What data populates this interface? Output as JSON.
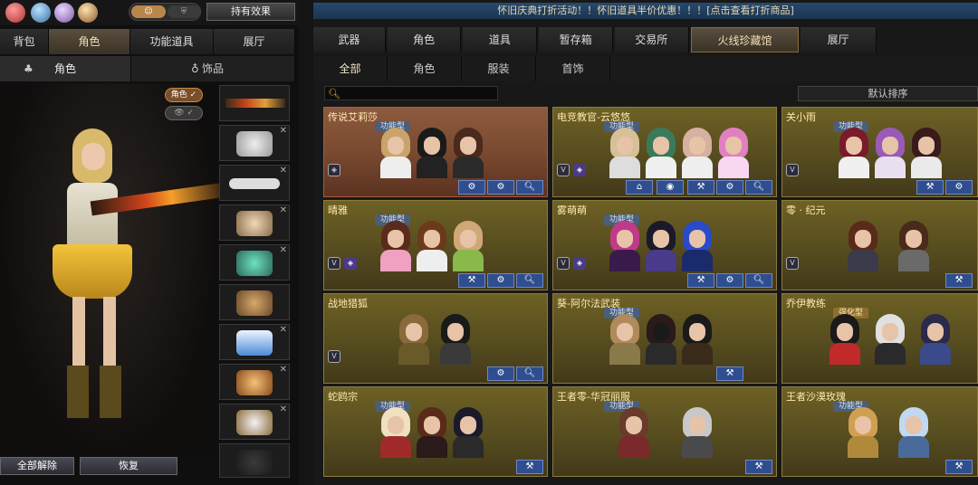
{
  "left": {
    "effect_btn": "持有效果",
    "tabs": [
      "背包",
      "角色",
      "功能道具",
      "展厅"
    ],
    "active_tab": 1,
    "subtabs": [
      "角色",
      "饰品"
    ],
    "chip_role": "角色 ✓",
    "chip_eye": "👁 ✓",
    "unequip_all": "全部解除",
    "restore": "恢复"
  },
  "right": {
    "ticker": "怀旧庆典打折活动！！怀旧道具半价优惠！！！[点击查看打折商品]",
    "tabs": [
      "武器",
      "角色",
      "道具",
      "暂存箱",
      "交易所",
      "火线珍藏馆",
      "展厅"
    ],
    "subtabs": [
      "全部",
      "角色",
      "服装",
      "首饰"
    ],
    "sort": "默认排序",
    "cards": [
      {
        "name": "传说艾莉莎",
        "tag": "功能型",
        "gold": false
      },
      {
        "name": "电竞教官-云悠悠",
        "tag": "功能型",
        "gold": false
      },
      {
        "name": "关小雨",
        "tag": "功能型",
        "gold": false
      },
      {
        "name": "晴雅",
        "tag": "功能型",
        "gold": false
      },
      {
        "name": "雾萌萌",
        "tag": "功能型",
        "gold": false
      },
      {
        "name": "零 · 纪元",
        "tag": "",
        "gold": false
      },
      {
        "name": "战地猎狐",
        "tag": "",
        "gold": false
      },
      {
        "name": "葵-阿尔法武装",
        "tag": "功能型",
        "gold": false
      },
      {
        "name": "乔伊教练",
        "tag": "强化型",
        "gold": true
      },
      {
        "name": "蛇鸥宗",
        "tag": "功能型",
        "gold": false
      },
      {
        "name": "王者零-华冠丽服",
        "tag": "功能型",
        "gold": false
      },
      {
        "name": "王者沙漠玫瑰",
        "tag": "功能型",
        "gold": false
      }
    ]
  }
}
